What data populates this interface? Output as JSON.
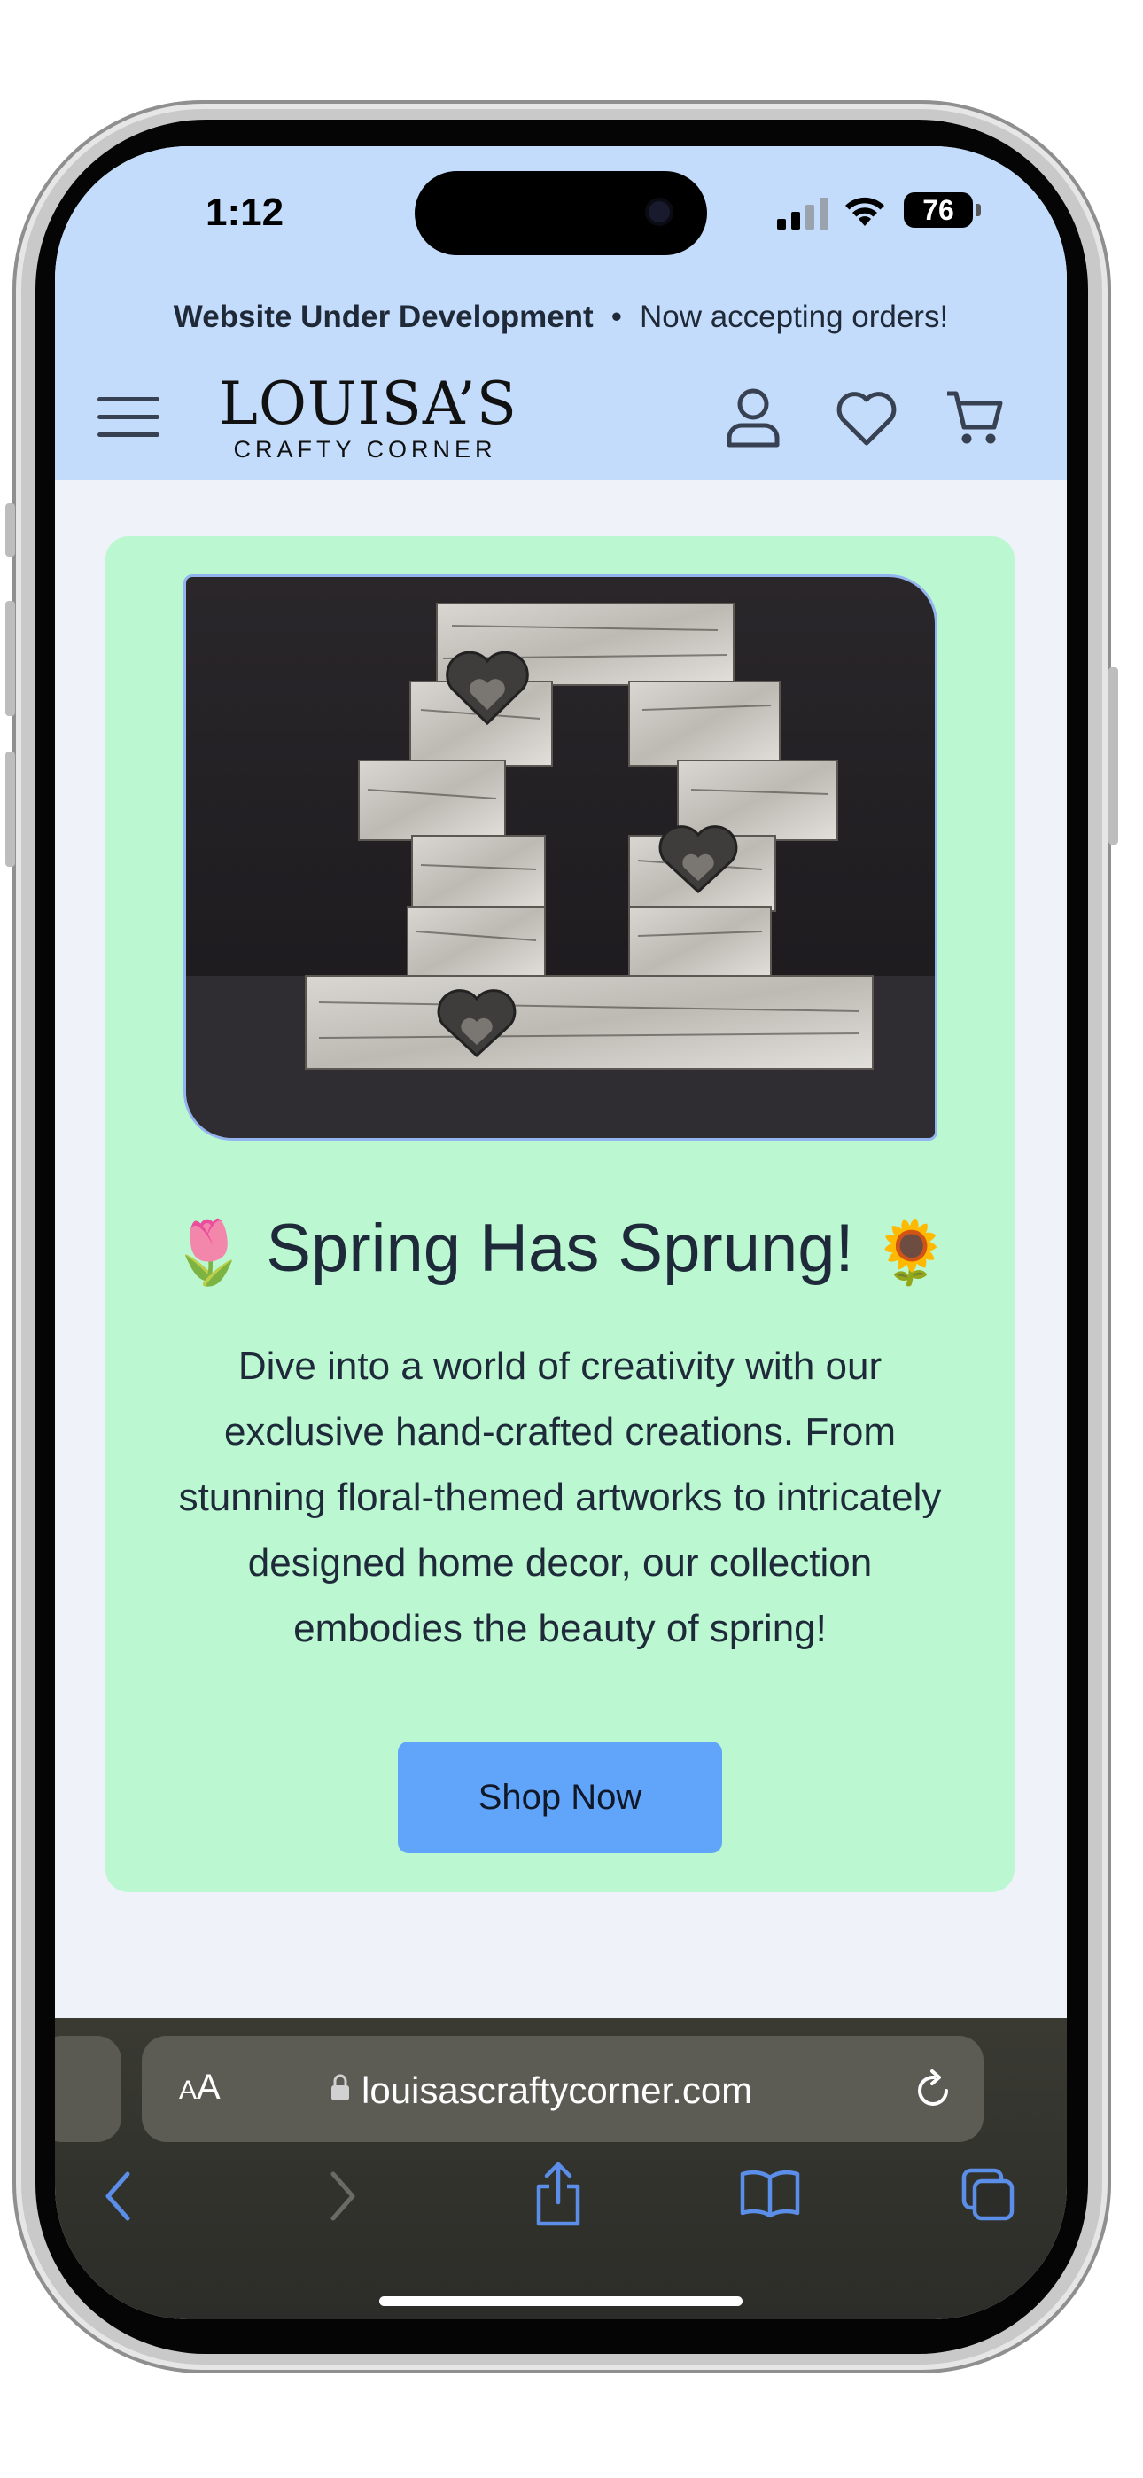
{
  "status_bar": {
    "time": "1:12",
    "battery": "76"
  },
  "announcement": {
    "bold": "Website Under Development",
    "separator": "•",
    "text": "Now accepting orders!"
  },
  "logo": {
    "line1": "LOUISA’S",
    "line2": "CRAFTY CORNER"
  },
  "nav": {
    "icons": [
      "menu-icon",
      "account-icon",
      "heart-icon",
      "cart-icon"
    ]
  },
  "hero": {
    "title": "Spring Has Sprung!",
    "title_emoji_left": "🌷",
    "title_emoji_right": "🌻",
    "body": "Dive into a world of creativity with our exclusive hand-crafted creations. From stunning floral-themed artworks to intricately designed home decor, our collection embodies the beauty of spring!",
    "button": "Shop Now"
  },
  "browser": {
    "text_size_label_small": "A",
    "text_size_label_large": "A",
    "url": "louisascraftycorner.com"
  },
  "colors": {
    "header_bg": "#c3dcfb",
    "page_bg": "#eff3f9",
    "card_bg": "#bbf7d0",
    "button_bg": "#60a5fa",
    "toolbar_icon": "#5b8ee8"
  }
}
